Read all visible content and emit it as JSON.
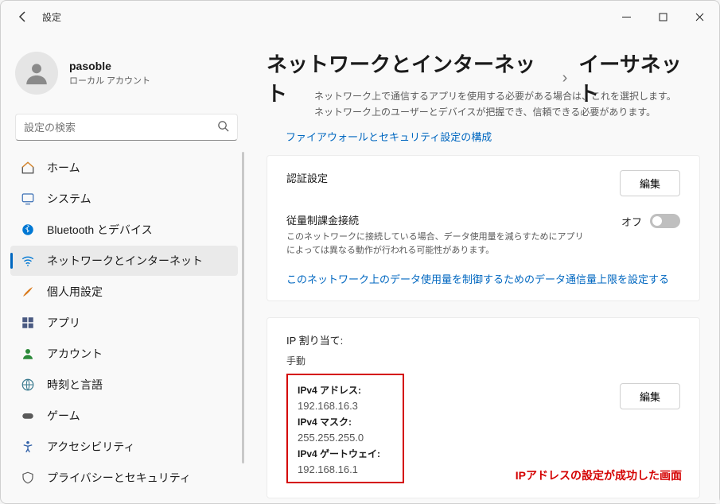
{
  "window": {
    "title": "設定"
  },
  "profile": {
    "name": "pasoble",
    "account_type": "ローカル アカウント"
  },
  "search": {
    "placeholder": "設定の検索"
  },
  "sidebar": {
    "items": [
      {
        "label": "ホーム"
      },
      {
        "label": "システム"
      },
      {
        "label": "Bluetooth とデバイス"
      },
      {
        "label": "ネットワークとインターネット"
      },
      {
        "label": "個人用設定"
      },
      {
        "label": "アプリ"
      },
      {
        "label": "アカウント"
      },
      {
        "label": "時刻と言語"
      },
      {
        "label": "ゲーム"
      },
      {
        "label": "アクセシビリティ"
      },
      {
        "label": "プライバシーとセキュリティ"
      }
    ]
  },
  "breadcrumb": {
    "root": "ネットワークとインターネット",
    "sep": "›",
    "leaf": "イーサネット"
  },
  "intro": {
    "text": "ネットワーク上で通信するアプリを使用する必要がある場合は、これを選択します。ネットワーク上のユーザーとデバイスが把握でき、信頼できる必要があります。",
    "firewall_link": "ファイアウォールとセキュリティ設定の構成"
  },
  "auth": {
    "label": "認証設定",
    "edit": "編集"
  },
  "metered": {
    "label": "従量制課金接続",
    "desc": "このネットワークに接続している場合、データ使用量を減らすためにアプリによっては異なる動作が行われる可能性があります。",
    "toggle_label": "オフ",
    "data_link": "このネットワーク上のデータ使用量を制御するためのデータ通信量上限を設定する"
  },
  "ip": {
    "assignment_label": "IP 割り当て:",
    "mode": "手動",
    "v4_addr_label": "IPv4 アドレス:",
    "v4_addr": "192.168.16.3",
    "v4_mask_label": "IPv4 マスク:",
    "v4_mask": "255.255.255.0",
    "v4_gw_label": "IPv4 ゲートウェイ:",
    "v4_gw": "192.168.16.1",
    "edit": "編集",
    "annotation": "IPアドレスの設定が成功した画面"
  }
}
